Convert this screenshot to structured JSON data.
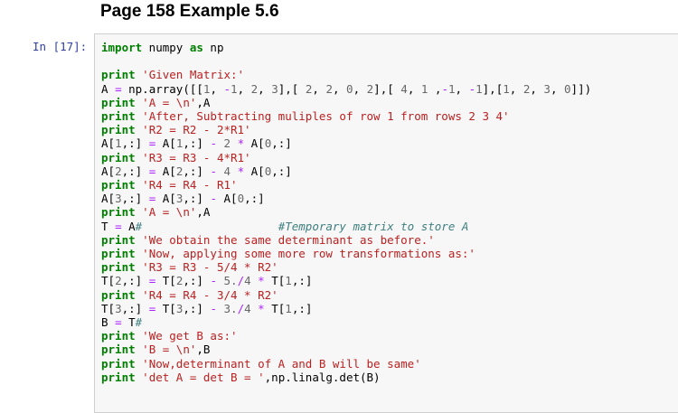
{
  "heading": "Page 158 Example 5.6",
  "cell": {
    "prompt": "In [17]:",
    "lines": [
      [
        [
          "kw",
          "import"
        ],
        [
          "nm",
          " numpy "
        ],
        [
          "kw",
          "as"
        ],
        [
          "nm",
          " np"
        ]
      ],
      [
        [
          "nm",
          ""
        ]
      ],
      [
        [
          "kw",
          "print"
        ],
        [
          "nm",
          " "
        ],
        [
          "str",
          "'Given Matrix:'"
        ]
      ],
      [
        [
          "nm",
          "A "
        ],
        [
          "op",
          "="
        ],
        [
          "nm",
          " np.array([["
        ],
        [
          "num",
          "1"
        ],
        [
          "nm",
          ", "
        ],
        [
          "op",
          "-"
        ],
        [
          "num",
          "1"
        ],
        [
          "nm",
          ", "
        ],
        [
          "num",
          "2"
        ],
        [
          "nm",
          ", "
        ],
        [
          "num",
          "3"
        ],
        [
          "nm",
          "],[ "
        ],
        [
          "num",
          "2"
        ],
        [
          "nm",
          ", "
        ],
        [
          "num",
          "2"
        ],
        [
          "nm",
          ", "
        ],
        [
          "num",
          "0"
        ],
        [
          "nm",
          ", "
        ],
        [
          "num",
          "2"
        ],
        [
          "nm",
          "],[ "
        ],
        [
          "num",
          "4"
        ],
        [
          "nm",
          ", "
        ],
        [
          "num",
          "1"
        ],
        [
          "nm",
          " ,"
        ],
        [
          "op",
          "-"
        ],
        [
          "num",
          "1"
        ],
        [
          "nm",
          ", "
        ],
        [
          "op",
          "-"
        ],
        [
          "num",
          "1"
        ],
        [
          "nm",
          "],["
        ],
        [
          "num",
          "1"
        ],
        [
          "nm",
          ", "
        ],
        [
          "num",
          "2"
        ],
        [
          "nm",
          ", "
        ],
        [
          "num",
          "3"
        ],
        [
          "nm",
          ", "
        ],
        [
          "num",
          "0"
        ],
        [
          "nm",
          "]])"
        ]
      ],
      [
        [
          "kw",
          "print"
        ],
        [
          "nm",
          " "
        ],
        [
          "str",
          "'A = \\n'"
        ],
        [
          "nm",
          ",A"
        ]
      ],
      [
        [
          "kw",
          "print"
        ],
        [
          "nm",
          " "
        ],
        [
          "str",
          "'After, Subtracting muliples of row 1 from rows 2 3 4'"
        ]
      ],
      [
        [
          "kw",
          "print"
        ],
        [
          "nm",
          " "
        ],
        [
          "str",
          "'R2 = R2 - 2*R1'"
        ]
      ],
      [
        [
          "nm",
          "A["
        ],
        [
          "num",
          "1"
        ],
        [
          "nm",
          ",:] "
        ],
        [
          "op",
          "="
        ],
        [
          "nm",
          " A["
        ],
        [
          "num",
          "1"
        ],
        [
          "nm",
          ",:] "
        ],
        [
          "op",
          "-"
        ],
        [
          "nm",
          " "
        ],
        [
          "num",
          "2"
        ],
        [
          "nm",
          " "
        ],
        [
          "op",
          "*"
        ],
        [
          "nm",
          " A["
        ],
        [
          "num",
          "0"
        ],
        [
          "nm",
          ",:]"
        ]
      ],
      [
        [
          "kw",
          "print"
        ],
        [
          "nm",
          " "
        ],
        [
          "str",
          "'R3 = R3 - 4*R1'"
        ]
      ],
      [
        [
          "nm",
          "A["
        ],
        [
          "num",
          "2"
        ],
        [
          "nm",
          ",:] "
        ],
        [
          "op",
          "="
        ],
        [
          "nm",
          " A["
        ],
        [
          "num",
          "2"
        ],
        [
          "nm",
          ",:] "
        ],
        [
          "op",
          "-"
        ],
        [
          "nm",
          " "
        ],
        [
          "num",
          "4"
        ],
        [
          "nm",
          " "
        ],
        [
          "op",
          "*"
        ],
        [
          "nm",
          " A["
        ],
        [
          "num",
          "0"
        ],
        [
          "nm",
          ",:]"
        ]
      ],
      [
        [
          "kw",
          "print"
        ],
        [
          "nm",
          " "
        ],
        [
          "str",
          "'R4 = R4 - R1'"
        ]
      ],
      [
        [
          "nm",
          "A["
        ],
        [
          "num",
          "3"
        ],
        [
          "nm",
          ",:] "
        ],
        [
          "op",
          "="
        ],
        [
          "nm",
          " A["
        ],
        [
          "num",
          "3"
        ],
        [
          "nm",
          ",:] "
        ],
        [
          "op",
          "-"
        ],
        [
          "nm",
          " A["
        ],
        [
          "num",
          "0"
        ],
        [
          "nm",
          ",:]"
        ]
      ],
      [
        [
          "kw",
          "print"
        ],
        [
          "nm",
          " "
        ],
        [
          "str",
          "'A = \\n'"
        ],
        [
          "nm",
          ",A"
        ]
      ],
      [
        [
          "nm",
          "T "
        ],
        [
          "op",
          "="
        ],
        [
          "nm",
          " A"
        ],
        [
          "cm",
          "#                    #Temporary matrix to store A"
        ]
      ],
      [
        [
          "kw",
          "print"
        ],
        [
          "nm",
          " "
        ],
        [
          "str",
          "'We obtain the same determinant as before.'"
        ]
      ],
      [
        [
          "kw",
          "print"
        ],
        [
          "nm",
          " "
        ],
        [
          "str",
          "'Now, applying some more row transformations as:'"
        ]
      ],
      [
        [
          "kw",
          "print"
        ],
        [
          "nm",
          " "
        ],
        [
          "str",
          "'R3 = R3 - 5/4 * R2'"
        ]
      ],
      [
        [
          "nm",
          "T["
        ],
        [
          "num",
          "2"
        ],
        [
          "nm",
          ",:] "
        ],
        [
          "op",
          "="
        ],
        [
          "nm",
          " T["
        ],
        [
          "num",
          "2"
        ],
        [
          "nm",
          ",:] "
        ],
        [
          "op",
          "-"
        ],
        [
          "nm",
          " "
        ],
        [
          "num",
          "5."
        ],
        [
          "op",
          "/"
        ],
        [
          "num",
          "4"
        ],
        [
          "nm",
          " "
        ],
        [
          "op",
          "*"
        ],
        [
          "nm",
          " T["
        ],
        [
          "num",
          "1"
        ],
        [
          "nm",
          ",:]"
        ]
      ],
      [
        [
          "kw",
          "print"
        ],
        [
          "nm",
          " "
        ],
        [
          "str",
          "'R4 = R4 - 3/4 * R2'"
        ]
      ],
      [
        [
          "nm",
          "T["
        ],
        [
          "num",
          "3"
        ],
        [
          "nm",
          ",:] "
        ],
        [
          "op",
          "="
        ],
        [
          "nm",
          " T["
        ],
        [
          "num",
          "3"
        ],
        [
          "nm",
          ",:] "
        ],
        [
          "op",
          "-"
        ],
        [
          "nm",
          " "
        ],
        [
          "num",
          "3."
        ],
        [
          "op",
          "/"
        ],
        [
          "num",
          "4"
        ],
        [
          "nm",
          " "
        ],
        [
          "op",
          "*"
        ],
        [
          "nm",
          " T["
        ],
        [
          "num",
          "1"
        ],
        [
          "nm",
          ",:]"
        ]
      ],
      [
        [
          "nm",
          "B "
        ],
        [
          "op",
          "="
        ],
        [
          "nm",
          " T"
        ],
        [
          "cm",
          "#"
        ]
      ],
      [
        [
          "kw",
          "print"
        ],
        [
          "nm",
          " "
        ],
        [
          "str",
          "'We get B as:'"
        ]
      ],
      [
        [
          "kw",
          "print"
        ],
        [
          "nm",
          " "
        ],
        [
          "str",
          "'B = \\n'"
        ],
        [
          "nm",
          ",B"
        ]
      ],
      [
        [
          "kw",
          "print"
        ],
        [
          "nm",
          " "
        ],
        [
          "str",
          "'Now,determinant of A and B will be same'"
        ]
      ],
      [
        [
          "kw",
          "print"
        ],
        [
          "nm",
          " "
        ],
        [
          "str",
          "'det A = det B = '"
        ],
        [
          "nm",
          ",np.linalg.det(B)"
        ]
      ]
    ]
  }
}
